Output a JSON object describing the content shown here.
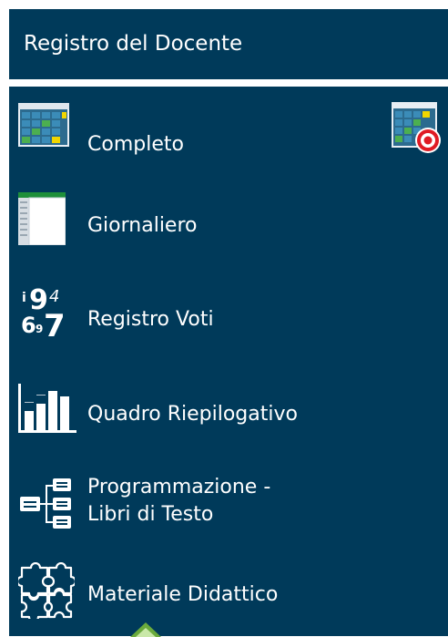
{
  "header": {
    "title": "Registro del Docente"
  },
  "menu": {
    "items": [
      {
        "label": "Completo",
        "icon": "grid-calendar-icon"
      },
      {
        "label": "Giornaliero",
        "icon": "daily-register-icon"
      },
      {
        "label": "Registro Voti",
        "icon": "grades-numbers-icon"
      },
      {
        "label": "Quadro Riepilogativo",
        "icon": "bar-chart-icon"
      },
      {
        "label_line1": "Programmazione -",
        "label_line2": "Libri di Testo",
        "icon": "tree-structure-icon"
      },
      {
        "label": "Materiale Didattico",
        "icon": "puzzle-icon"
      }
    ],
    "extra_icon": "grid-calendar-target-icon"
  },
  "colors": {
    "panel_bg": "#003a5a",
    "text": "#ffffff",
    "pointer": "#6aaa3c"
  }
}
